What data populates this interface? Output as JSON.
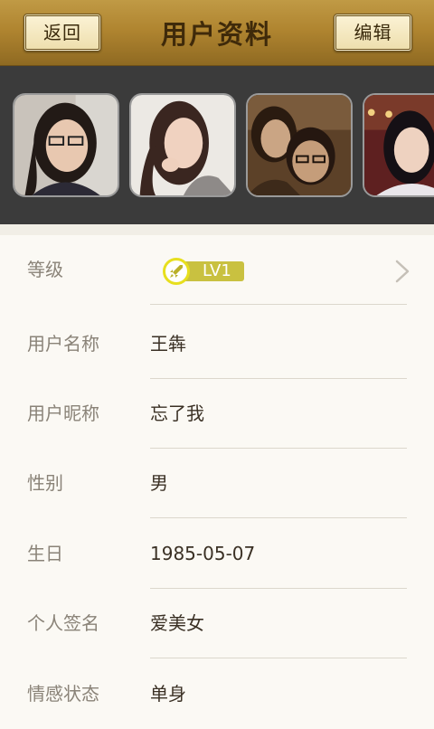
{
  "header": {
    "back_label": "返回",
    "title": "用户资料",
    "edit_label": "编辑"
  },
  "photos": [
    {
      "name": "user-photo-1"
    },
    {
      "name": "user-photo-2"
    },
    {
      "name": "user-photo-3"
    },
    {
      "name": "user-photo-4"
    }
  ],
  "profile": {
    "level": {
      "label": "等级",
      "value": "LV1",
      "icon": "rocket-icon"
    },
    "username": {
      "label": "用户名称",
      "value": "王犇"
    },
    "nickname": {
      "label": "用户昵称",
      "value": "忘了我"
    },
    "gender": {
      "label": "性别",
      "value": "男"
    },
    "birthday": {
      "label": "生日",
      "value": "1985-05-07"
    },
    "signature": {
      "label": "个人签名",
      "value": "爱美女"
    },
    "relationship": {
      "label": "情感状态",
      "value": "单身"
    }
  },
  "colors": {
    "header_gold": "#b08530",
    "badge_yellow": "#c9c140",
    "background": "#fbf9f4"
  }
}
